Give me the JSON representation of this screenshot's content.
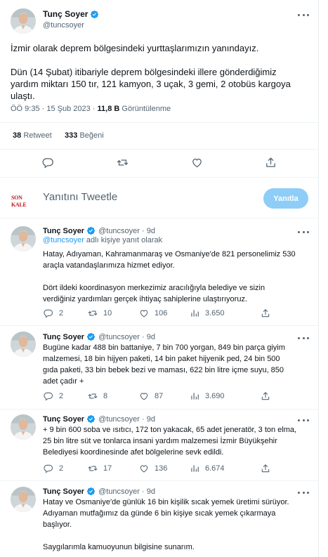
{
  "main_tweet": {
    "author_name": "Tunç Soyer",
    "handle": "@tuncsoyer",
    "text_p1": "İzmir olarak deprem bölgesindeki yurttaşlarımızın yanındayız.",
    "text_p2_l1": "Dün (14 Şubat) itibariyle deprem bölgesindeki illere gönderdiğimiz",
    "text_p2_l2": "yardım miktarı 150 tır, 121 kamyon, 3 uçak, 3 gemi, 2 otobüs kargoya",
    "text_p2_l3": "ulaştı.",
    "time": "ÖÖ 9:35 · 15 Şub 2023 · ",
    "views_count": "11,8 B",
    "views_label": "Görüntülenme",
    "retweets_count": "38",
    "retweets_label": "Retweet",
    "likes_count": "333",
    "likes_label": "Beğeni"
  },
  "compose": {
    "logo_text": "SON KALE",
    "placeholder": "Yanıtını Tweetle",
    "button_label": "Yanıtla"
  },
  "replies": [
    {
      "author_name": "Tunç Soyer",
      "handle_time": "@tuncsoyer · 9d",
      "replying_mention": "@tuncsoyer",
      "replying_suffix": " adlı kişiye yanıt olarak",
      "l1": "Hatay, Adıyaman, Kahramanmaraş ve Osmaniye'de 821 personelimiz 530",
      "l2": "araçla vatandaşlarımıza hizmet ediyor.",
      "l3": "Dört ildeki koordinasyon merkezimiz aracılığıyla belediye ve sizin",
      "l4": "verdiğiniz yardımları gerçek ihtiyaç sahiplerine ulaştırıyoruz.",
      "replies": "2",
      "retweets": "10",
      "likes": "106",
      "views": "3.650"
    },
    {
      "author_name": "Tunç Soyer",
      "handle_time": "@tuncsoyer · 9d",
      "l1": "Bugüne kadar 488 bin battaniye, 7 bin 700 yorgan, 849 bin parça giyim",
      "l2": "malzemesi, 18 bin hijyen paketi, 14 bin paket hijyenik ped, 24 bin 500",
      "l3": "gıda paketi, 33 bin bebek bezi ve maması, 622 bin litre içme suyu, 850",
      "l4": "adet çadır +",
      "replies": "2",
      "retweets": "8",
      "likes": "87",
      "views": "3.690"
    },
    {
      "author_name": "Tunç Soyer",
      "handle_time": "@tuncsoyer · 9d",
      "l1": "+ 9 bin 600 soba ve ısıtıcı, 172 ton yakacak, 65 adet jeneratör, 3 ton elma,",
      "l2": "25 bin litre süt ve tonlarca insani yardım malzemesi İzmir Büyükşehir",
      "l3": "Belediyesi koordinesinde afet bölgelerine sevk edildi.",
      "replies": "2",
      "retweets": "17",
      "likes": "136",
      "views": "6.674"
    },
    {
      "author_name": "Tunç Soyer",
      "handle_time": "@tuncsoyer · 9d",
      "l1": "Hatay ve Osmaniye'de günlük 16 bin kişilik sıcak yemek üretimi sürüyor.",
      "l2": "Adıyaman mutfağımız da günde 6 bin kişiye sıcak yemek çıkarmaya",
      "l3": "başlıyor.",
      "l4": "Saygılarımla kamuoyunun bilgisine sunarım."
    }
  ],
  "icons": {
    "verified": "verified-badge-icon",
    "more": "more-icon",
    "reply": "reply-icon",
    "retweet": "retweet-icon",
    "like": "like-icon",
    "views": "views-icon",
    "share": "share-icon"
  },
  "colors": {
    "accent": "#1d9bf0",
    "reply_button": "#8ecdf8",
    "text": "#0f1419",
    "muted": "#536471"
  }
}
